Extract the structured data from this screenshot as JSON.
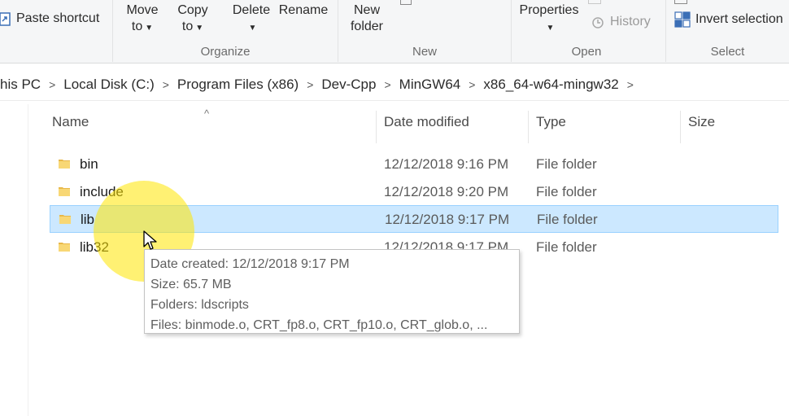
{
  "ribbon": {
    "clipboard": {
      "paste_shortcut_label": "Paste shortcut"
    },
    "organize": {
      "move_to_label": "Move",
      "move_to_sub": "to",
      "copy_to_label": "Copy",
      "copy_to_sub": "to",
      "delete_label": "Delete",
      "rename_label": "Rename",
      "group_label": "Organize"
    },
    "new": {
      "new_folder_label": "New",
      "new_folder_sub": "folder",
      "group_label": "New"
    },
    "open": {
      "properties_label": "Properties",
      "history_label": "History",
      "group_label": "Open"
    },
    "select": {
      "invert_selection_label": "Invert selection",
      "group_label": "Select"
    }
  },
  "address": {
    "crumbs": [
      "his PC",
      "Local Disk (C:)",
      "Program Files (x86)",
      "Dev-Cpp",
      "MinGW64",
      "x86_64-w64-mingw32"
    ]
  },
  "columns": {
    "name": "Name",
    "date_modified": "Date modified",
    "type": "Type",
    "size": "Size"
  },
  "files": [
    {
      "name": "bin",
      "date": "12/12/2018 9:16 PM",
      "type": "File folder"
    },
    {
      "name": "include",
      "date": "12/12/2018 9:20 PM",
      "type": "File folder"
    },
    {
      "name": "lib",
      "date": "12/12/2018 9:17 PM",
      "type": "File folder",
      "selected": true
    },
    {
      "name": "lib32",
      "date": "12/12/2018 9:17 PM",
      "type": "File folder"
    }
  ],
  "tooltip": {
    "date_created": "Date created: 12/12/2018 9:17 PM",
    "size": "Size: 65.7 MB",
    "folders": "Folders: ldscripts",
    "files": "Files: binmode.o, CRT_fp8.o, CRT_fp10.o, CRT_glob.o, ..."
  },
  "icons": {
    "folder": "folder-icon",
    "cursor": "mouse-pointer-icon",
    "sort": "sort-ascending-icon"
  },
  "colors": {
    "selection_bg": "#cce8ff",
    "selection_border": "#99d1ff",
    "folder_yellow": "#f8d775",
    "highlight": "#ffe600"
  }
}
